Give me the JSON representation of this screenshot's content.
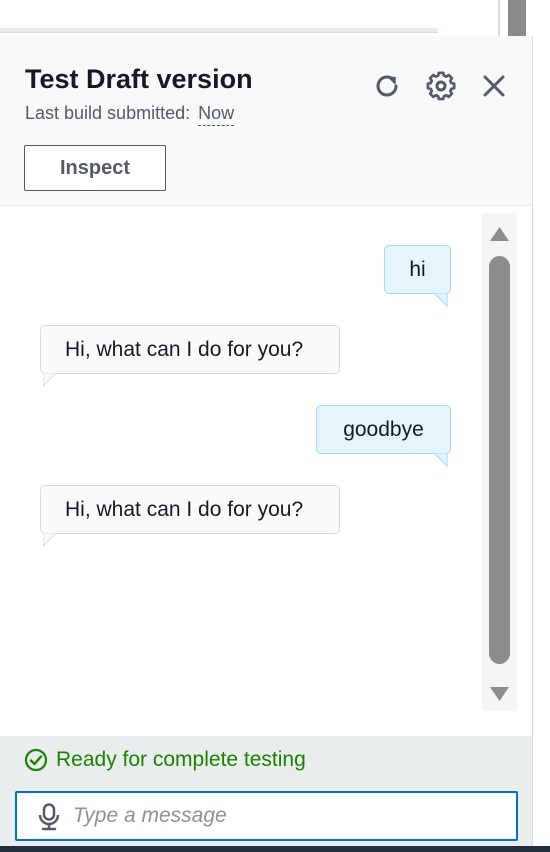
{
  "panel": {
    "title": "Test Draft version",
    "last_build_label": "Last build submitted:",
    "last_build_value": "Now",
    "inspect_label": "Inspect",
    "icons": [
      "refresh-icon",
      "gear-icon",
      "close-icon"
    ]
  },
  "conversation": [
    {
      "from": "user",
      "text": "hi"
    },
    {
      "from": "bot",
      "text": "Hi, what can I do for you?"
    },
    {
      "from": "user",
      "text": "goodbye"
    },
    {
      "from": "bot",
      "text": "Hi, what can I do for you?"
    }
  ],
  "footer": {
    "status_text": "Ready for complete testing",
    "status_color": "#1d8102",
    "input_placeholder": "Type a message",
    "input_value": ""
  },
  "colors": {
    "accent": "#0073bb",
    "user_bubble": "#e6f4fc",
    "bot_bubble": "#f9fbfb"
  }
}
